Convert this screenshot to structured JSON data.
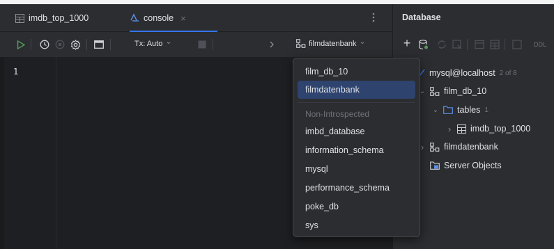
{
  "editor": {
    "tabs": [
      {
        "label": "imdb_top_1000",
        "icon": "table-icon",
        "active": false
      },
      {
        "label": "console",
        "icon": "console-icon",
        "active": true,
        "close": "×"
      }
    ],
    "menu_icon": "more-vertical-icon",
    "toolbar": {
      "run_icon": "play-icon",
      "history_icon": "clock-icon",
      "stop_icon": "stop-circle-icon",
      "settings_icon": "gear-icon",
      "layout_icon": "panel-icon",
      "tx_label": "Tx: Auto",
      "tx_chevron": "⌄",
      "cancel_icon": "square-icon",
      "forward_icon": "chevron-right-icon",
      "schema_label": "filmdatenbank",
      "schema_chevron": "⌄"
    },
    "line_number": "1"
  },
  "database": {
    "title": "Database",
    "toolbar": {
      "add": "+",
      "ddl": "DDL"
    },
    "tree": [
      {
        "label": "mysql@localhost",
        "badge": "2 of 8",
        "icon": "datasource-icon",
        "chevron": ""
      },
      {
        "label": "film_db_10",
        "icon": "schema-icon",
        "chevron": "⌄"
      },
      {
        "label": "tables",
        "badge": "1",
        "icon": "folder-icon",
        "chevron": "⌄"
      },
      {
        "label": "imdb_top_1000",
        "icon": "table-icon",
        "chevron": "›"
      },
      {
        "label": "filmdatenbank",
        "icon": "schema-icon",
        "chevron": "›"
      },
      {
        "label": "Server Objects",
        "icon": "server-objects-icon",
        "chevron": ""
      }
    ]
  },
  "popup": {
    "introspected": [
      "film_db_10",
      "filmdatenbank"
    ],
    "selected": "filmdatenbank",
    "header": "Non-Introspected",
    "others": [
      "imbd_database",
      "information_schema",
      "mysql",
      "performance_schema",
      "poke_db",
      "sys"
    ]
  },
  "colors": {
    "accent": "#3574f0",
    "selection": "#2e436e",
    "run_green": "#57965c",
    "panel_bg": "#2b2d30",
    "editor_bg": "#1e1f22"
  }
}
